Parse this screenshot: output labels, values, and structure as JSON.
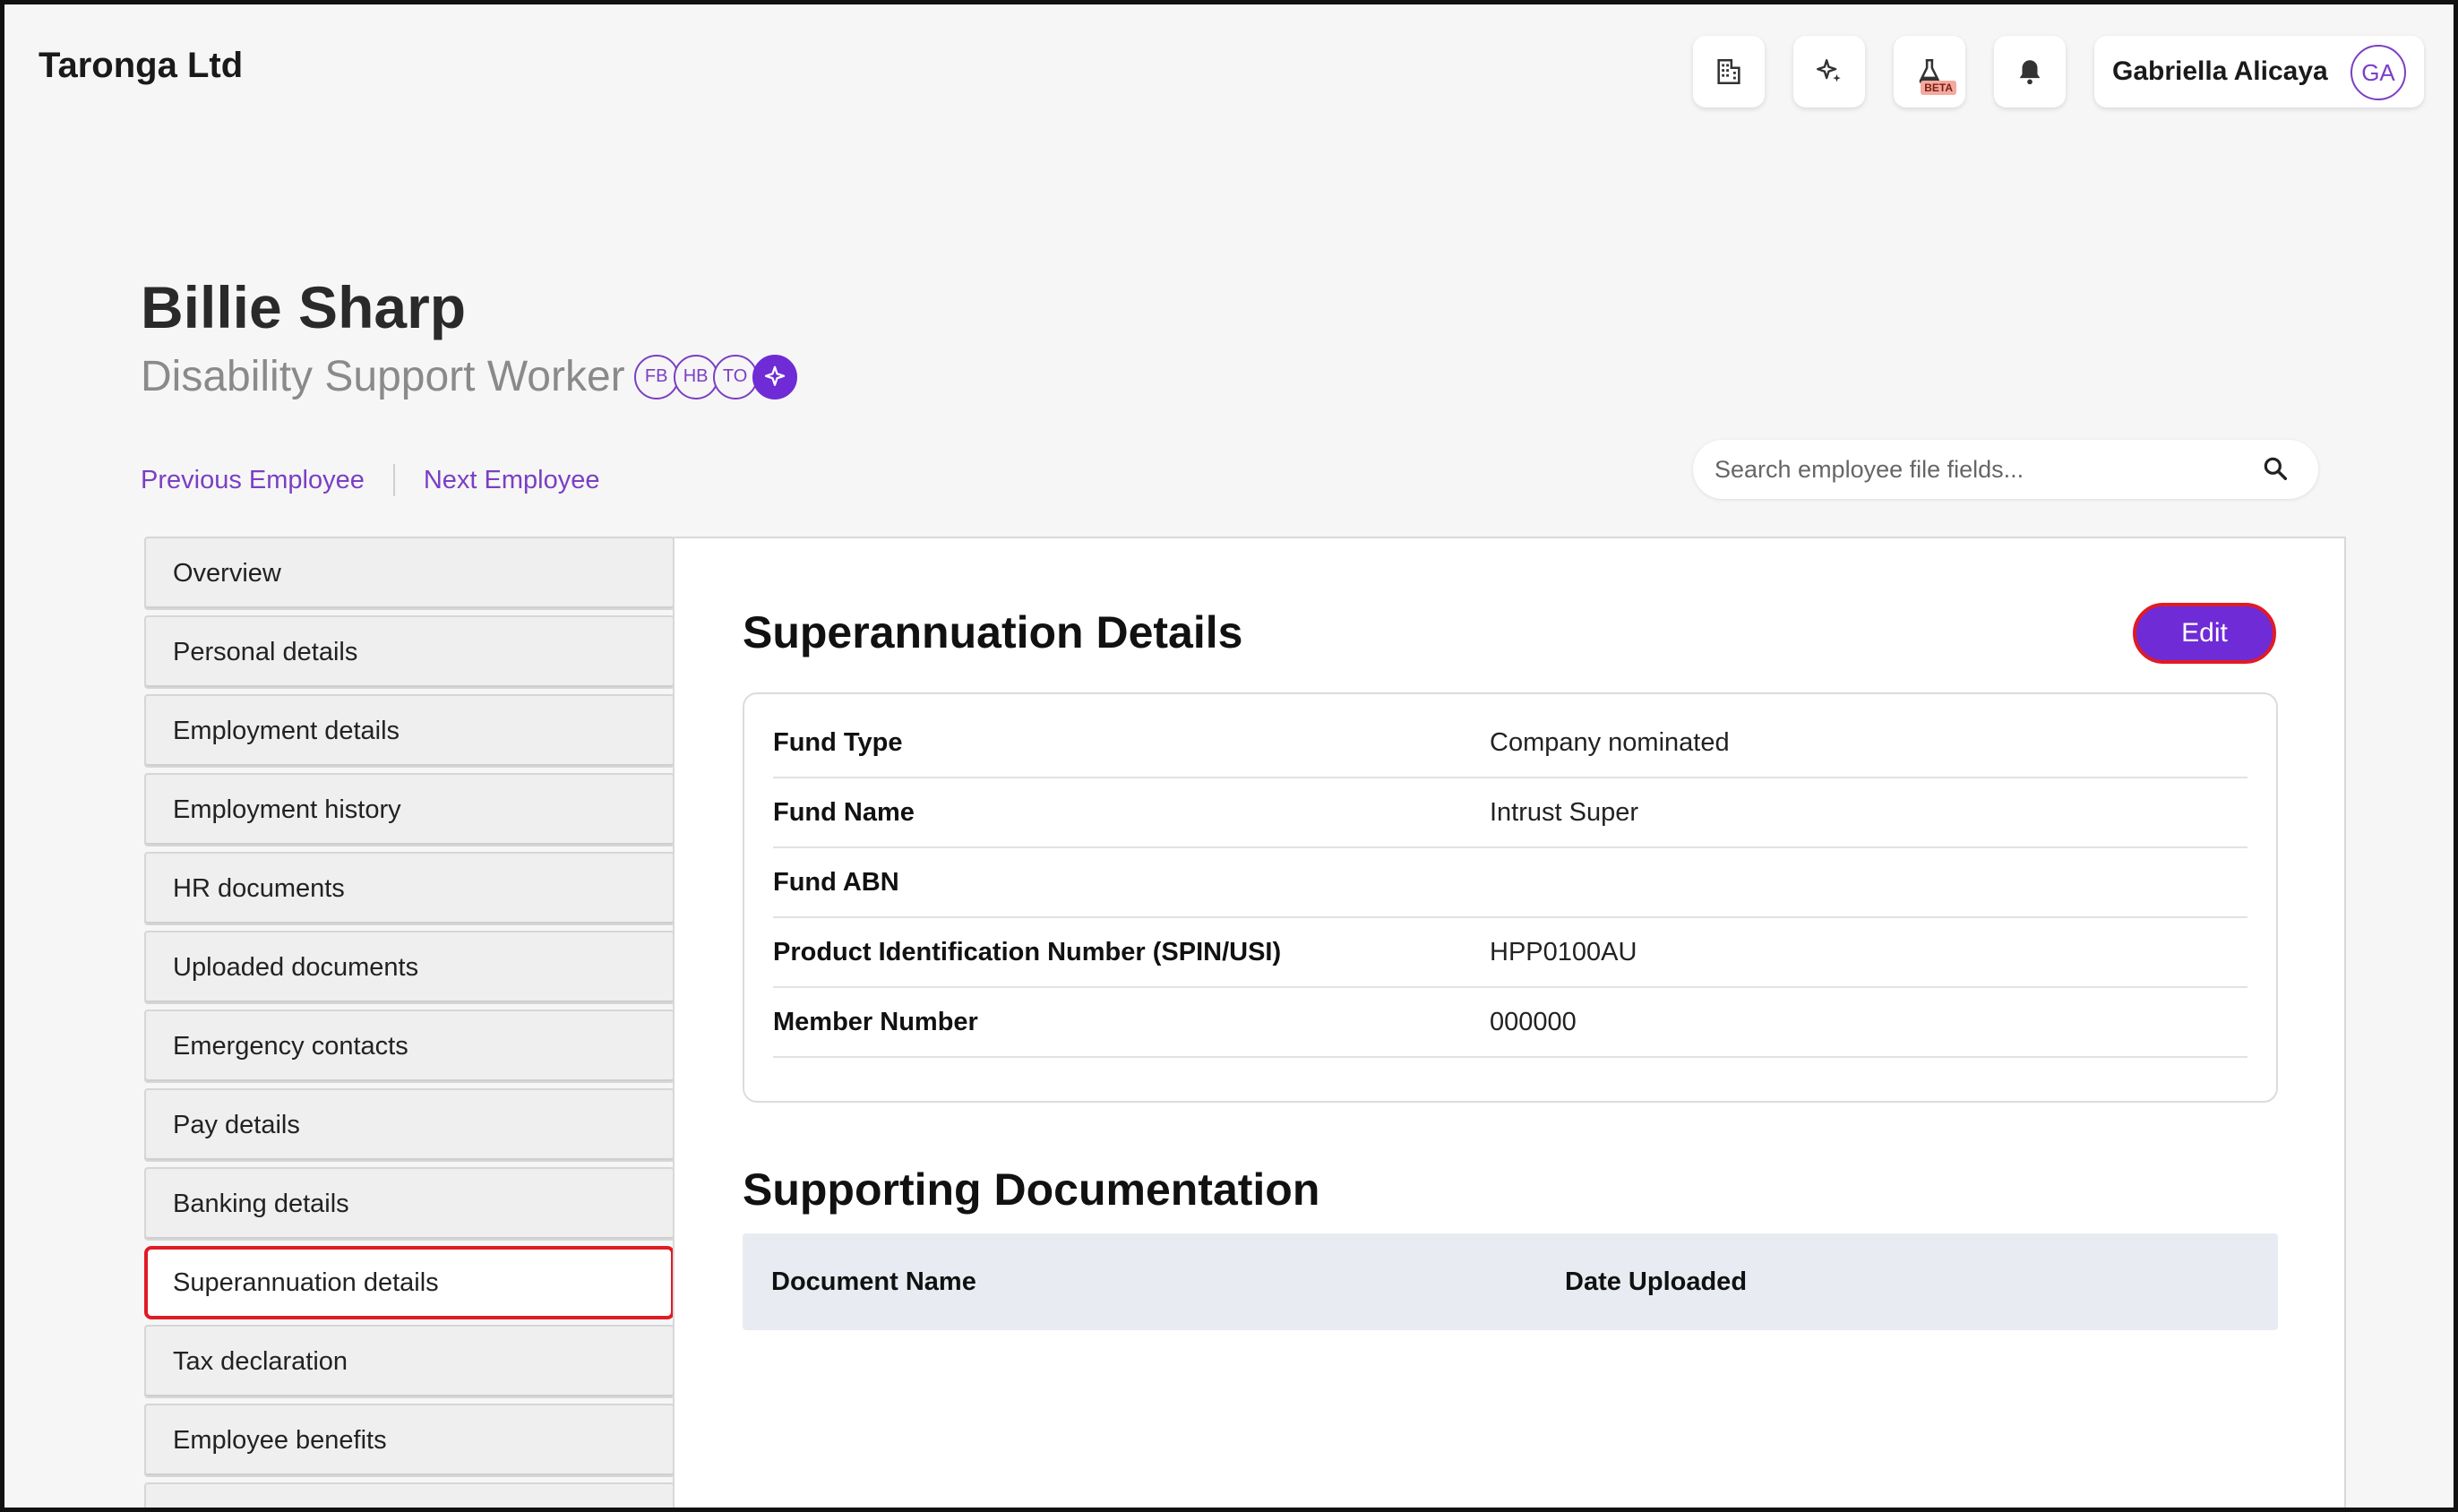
{
  "header": {
    "company": "Taronga Ltd",
    "icons": [
      "building-icon",
      "sparkle-icon",
      "flask-icon",
      "bell-icon"
    ],
    "beta_label": "BETA",
    "user_name": "Gabriella Alicaya",
    "user_initials": "GA"
  },
  "employee": {
    "name": "Billie Sharp",
    "role": "Disability Support Worker",
    "badges": [
      "FB",
      "HB",
      "TO"
    ],
    "prev_label": "Previous Employee",
    "next_label": "Next Employee"
  },
  "search": {
    "placeholder": "Search employee file fields..."
  },
  "sidebar": {
    "items": [
      {
        "label": "Overview"
      },
      {
        "label": "Personal details"
      },
      {
        "label": "Employment details"
      },
      {
        "label": "Employment history"
      },
      {
        "label": "HR documents"
      },
      {
        "label": "Uploaded documents"
      },
      {
        "label": "Emergency contacts"
      },
      {
        "label": "Pay details"
      },
      {
        "label": "Banking details"
      },
      {
        "label": "Superannuation details"
      },
      {
        "label": "Tax declaration"
      },
      {
        "label": "Employee benefits"
      }
    ],
    "active_index": 9
  },
  "main": {
    "title": "Superannuation Details",
    "edit_label": "Edit",
    "fields": [
      {
        "label": "Fund Type",
        "value": "Company nominated"
      },
      {
        "label": "Fund Name",
        "value": "Intrust Super"
      },
      {
        "label": "Fund ABN",
        "value": ""
      },
      {
        "label": "Product Identification Number (SPIN/USI)",
        "value": "HPP0100AU"
      },
      {
        "label": "Member Number",
        "value": "000000"
      }
    ],
    "docs_title": "Supporting Documentation",
    "docs_columns": [
      "Document Name",
      "Date Uploaded"
    ]
  },
  "colors": {
    "accent": "#6f2bd6",
    "link": "#7b3fc4",
    "highlight": "#e01b24"
  }
}
